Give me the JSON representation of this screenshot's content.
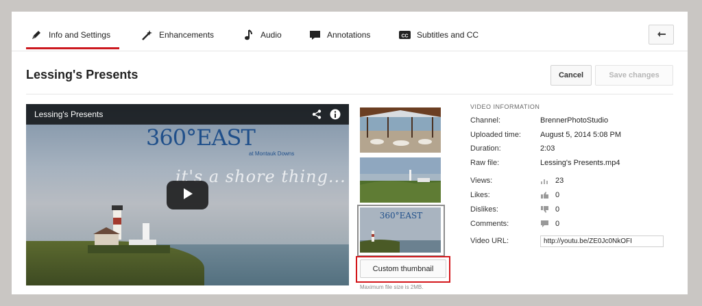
{
  "tabs": [
    {
      "label": "Info and Settings",
      "icon": "pencil-icon",
      "active": true
    },
    {
      "label": "Enhancements",
      "icon": "magic-wand-icon"
    },
    {
      "label": "Audio",
      "icon": "music-note-icon"
    },
    {
      "label": "Annotations",
      "icon": "speech-bubble-icon"
    },
    {
      "label": "Subtitles and CC",
      "icon": "cc-icon"
    }
  ],
  "header": {
    "title": "Lessing's Presents",
    "cancel_label": "Cancel",
    "save_label": "Save changes"
  },
  "player": {
    "title": "Lessing's Presents",
    "logo_text": "360°EAST",
    "logo_sub": "at Montauk Downs",
    "tagline": "it's a shore thing..."
  },
  "thumbnails": {
    "mini_logo": "360°EAST",
    "custom_label": "Custom thumbnail",
    "note": "Maximum file size is 2MB."
  },
  "video_info": {
    "heading": "VIDEO INFORMATION",
    "rows": [
      {
        "label": "Channel:",
        "value": "BrennerPhotoStudio"
      },
      {
        "label": "Uploaded time:",
        "value": "August 5, 2014 5:08 PM"
      },
      {
        "label": "Duration:",
        "value": "2:03"
      },
      {
        "label": "Raw file:",
        "value": "Lessing's Presents.mp4"
      },
      {
        "label": "Views:",
        "value": "23"
      },
      {
        "label": "Likes:",
        "value": "0"
      },
      {
        "label": "Dislikes:",
        "value": "0"
      },
      {
        "label": "Comments:",
        "value": "0"
      },
      {
        "label": "Video URL:",
        "value": "http://youtu.be/ZE0Jc0NkOFI"
      }
    ]
  },
  "colors": {
    "accent": "#cc181e",
    "highlight_box": "#d3161a"
  }
}
